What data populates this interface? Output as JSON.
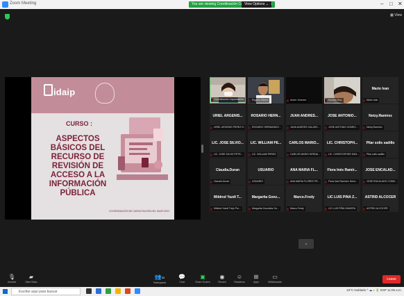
{
  "window": {
    "title": "Zoom Meeting"
  },
  "share_banner": "You are viewing Coordinación Capacitación's screen",
  "view_options": "View Options ⌄",
  "gallery_view": "▦ View",
  "slide": {
    "logo": "idaip",
    "curso": "CURSO :",
    "heading": "ASPECTOS BÁSICOS DEL RECURSO DE REVISIÓN DE ACCESO A LA INFORMACIÓN PÚBLICA",
    "coordination": "COORDINACIÓN DE CAPACITACIÓN DEL IDAIP-DGO"
  },
  "participants": [
    {
      "name": "",
      "label": "Coordinación Capacitación",
      "video": "face1",
      "active": true
    },
    {
      "name": "",
      "label": "Rogelio Olvera",
      "video": "face2"
    },
    {
      "name": "",
      "label": "Andre Jimenez",
      "video": "dark"
    },
    {
      "name": "",
      "label": "Susana Ruiz",
      "video": "face3"
    },
    {
      "name": "Mario Ivan",
      "label": "Mario Ivan"
    },
    {
      "name": "URIEL ARGENIS...",
      "label": "URIEL ARGENIS PEREZ R..."
    },
    {
      "name": "ROSARIO HERN...",
      "label": "ROSARIO HERNANDEZ..."
    },
    {
      "name": "JUAN ANDRES...",
      "label": "JUAN ANDRES GALARZ..."
    },
    {
      "name": "JOSE ANTONIO...",
      "label": "JOSE ANTONIO GOMEZ..."
    },
    {
      "name": "Netzy.Ramirez",
      "label": "Netzy.Ramirez"
    },
    {
      "name": "LIC. JOSE SILVIO...",
      "label": "LIC. JOSE SILVIO PETR..."
    },
    {
      "name": "LIC. WILLIAM PE...",
      "label": "LIC. WILLIAM PEREZ"
    },
    {
      "name": "CARLOS MARIO...",
      "label": "CARLOS MARIO HERNA..."
    },
    {
      "name": "LIC. CHRISTOPH...",
      "label": "LIC. CHRISTOPHER SAN..."
    },
    {
      "name": "Pilar solis sadillo",
      "label": "Pilar solis sadillo"
    },
    {
      "name": "Claudia.Duran",
      "label": "Claudia.Duran"
    },
    {
      "name": "USUARIO",
      "label": "USUARIO"
    },
    {
      "name": "ANA MARIA FL...",
      "label": "ANA MARIA FLORES FR..."
    },
    {
      "name": "Flora Inés Ramír...",
      "label": "Flora Inés Ramírez Herm..."
    },
    {
      "name": "JOSE ENCALAD...",
      "label": "JOSE ENCALADO COMO..."
    },
    {
      "name": "Mildred Yazdi T...",
      "label": "Mildred Yazdi Trejo Pui..."
    },
    {
      "name": "Margarita Gonz...",
      "label": "Margarita González Go..."
    },
    {
      "name": "Marco.Fredy",
      "label": "Marco.Fredy"
    },
    {
      "name": "LIC LUIS PIÑA Z...",
      "label": "LIC LUIS PIÑA ZAMORA"
    },
    {
      "name": "ASTRID ALCOCER",
      "label": "ASTRID ALCOCER"
    }
  ],
  "scroll_down": "⌄",
  "toolbar": {
    "unmute": "Unmute",
    "start_video": "Start Video",
    "participants": "Participants",
    "participants_count": "55",
    "chat": "Chat",
    "share_screen": "Share Screen",
    "record": "Record",
    "reactions": "Reactions",
    "apps": "Apps",
    "whiteboards": "Whiteboards",
    "leave": "Leave"
  },
  "taskbar": {
    "search": "Escribe aquí para buscar",
    "tray": "19°C Nublado  ^  ☁ ♪ 🔋 ESP  11:05 a.m."
  },
  "colors": {
    "accent_green": "#23d95a",
    "leave_red": "#e02828",
    "slide_wine": "#7b2238"
  }
}
